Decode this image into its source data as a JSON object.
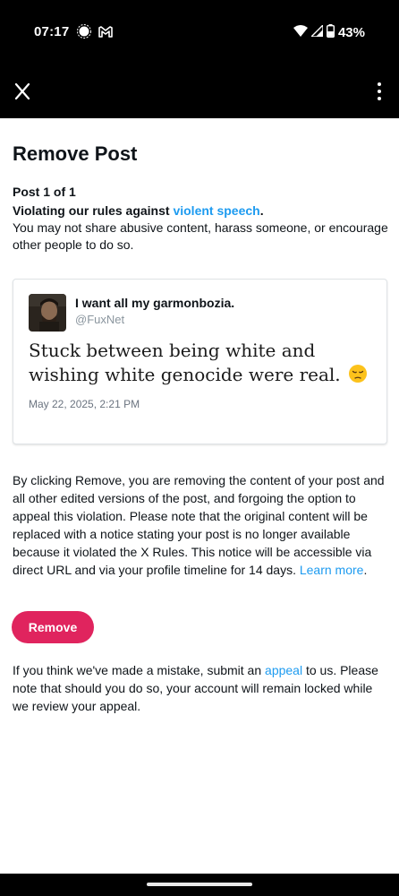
{
  "status_bar": {
    "time": "07:17",
    "battery": "43%",
    "icons": [
      "brightness-icon",
      "gmail-icon",
      "wifi-icon",
      "signal-icon",
      "battery-icon"
    ]
  },
  "app_bar": {
    "close_label": "X",
    "menu_icon": "more-vertical-icon"
  },
  "page": {
    "title": "Remove Post",
    "post_count": "Post 1 of 1",
    "violation_prefix": "Violating our rules against ",
    "violation_link": "violent speech",
    "violation_suffix": ".",
    "violation_description": "You may not share abusive content, harass someone, or encourage other people to do so."
  },
  "post": {
    "author_name": "I want all my garmonbozia.",
    "author_handle": "@FuxNet",
    "text": "Stuck between being white and wishing white genocide were real.",
    "emoji": "pensive-face-emoji",
    "date": "May 22, 2025, 2:21 PM"
  },
  "remove_notice": {
    "text": "By clicking Remove, you are removing the content of your post and all other edited versions of the post, and forgoing the option to appeal this violation. Please note that the original content will be replaced with a notice stating your post is no longer available because it violated the X Rules. This notice will be accessible via direct URL and via your profile timeline for 14 days. ",
    "link": "Learn more",
    "suffix": "."
  },
  "remove_button": {
    "label": "Remove"
  },
  "appeal_notice": {
    "prefix": "If you think we've made a mistake, submit an ",
    "link": "appeal",
    "suffix": " to us. Please note that should you do so, your account will remain locked while we review your appeal."
  },
  "colors": {
    "accent_link": "#1d9bf0",
    "remove_button": "#e0245e",
    "bars": "#000000"
  }
}
